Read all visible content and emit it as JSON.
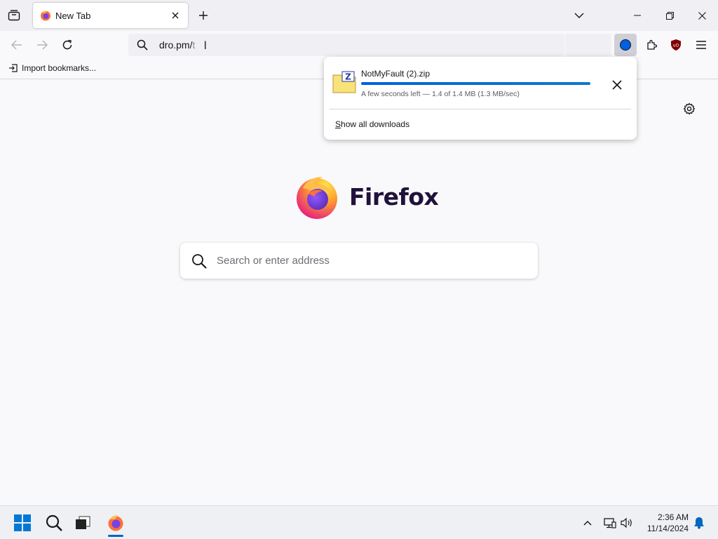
{
  "browser": {
    "tab": {
      "title": "New Tab"
    },
    "urlbar": {
      "typed": "dro.pm/",
      "suffix": "t"
    },
    "bookmarks": {
      "import_label": "Import bookmarks..."
    }
  },
  "newtab": {
    "brand": "Firefox",
    "search_placeholder": "Search or enter address"
  },
  "downloads_panel": {
    "item": {
      "filename": "NotMyFault (2).zip",
      "status": "A few seconds left — 1.4 of 1.4 MB (1.3 MB/sec)",
      "progress_percent": 100
    },
    "show_all_label_accesskey": "S",
    "show_all_label_rest": "how all downloads"
  },
  "taskbar": {
    "time": "2:36 AM",
    "date": "11/14/2024"
  },
  "colors": {
    "accent": "#0061e0",
    "tab_strip": "#f0f0f4",
    "taskbar_active": "#0067c0"
  },
  "icons": [
    "tab-list-icon",
    "firefox-favicon",
    "close-icon",
    "plus-icon",
    "chevron-down-icon",
    "minimize-icon",
    "restore-icon",
    "back-arrow-icon",
    "forward-arrow-icon",
    "reload-icon",
    "search-icon",
    "downloads-icon",
    "extensions-icon",
    "ublock-icon",
    "hamburger-menu-icon",
    "import-icon",
    "gear-icon",
    "zip-file-icon",
    "windows-start-icon",
    "file-explorer-icon",
    "chevron-up-icon",
    "network-icon",
    "volume-icon",
    "bell-icon"
  ]
}
